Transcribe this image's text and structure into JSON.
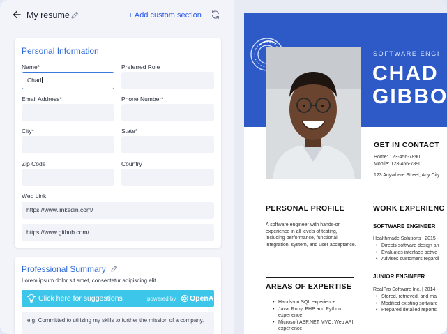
{
  "header": {
    "title": "My resume",
    "add_section_label": "+ Add custom section"
  },
  "personal": {
    "heading": "Personal Information",
    "name_label": "Name*",
    "name_value": "Chad",
    "role_label": "Preferred Role",
    "email_label": "Email Address*",
    "phone_label": "Phone Number*",
    "city_label": "City*",
    "state_label": "State*",
    "zip_label": "Zip Code",
    "country_label": "Country",
    "weblink_label": "Web Link",
    "links": [
      "https://www.linkedin.com/",
      "https://www.github.com/"
    ]
  },
  "summary": {
    "heading": "Professional Summary",
    "subtext": "Lorem ipsum dolor sit amet, consectetur adipiscing elit.",
    "suggest_label": "Click here for suggestions",
    "powered_by": "powered by",
    "provider": "OpenAI",
    "placeholder": "e.g. Committed to utilizing my skills to further the mission of a company."
  },
  "resume": {
    "role": "SOFTWARE ENGI",
    "first_name": "CHAD",
    "last_name": "GIBBO",
    "contact_heading": "GET IN CONTACT",
    "home_phone": "Home: 123-456-7890",
    "mobile_phone": "Mobile: 123-456-7890",
    "address": "123 Anywhere Street, Any City",
    "profile_heading": "PERSONAL PROFILE",
    "profile_text": "A software engineer with hands-on experience in all levels of testing, including performance, functional, integration, system, and user acceptance.",
    "expertise_heading": "AREAS OF EXPERTISE",
    "expertise": [
      "Hands-on SQL experience",
      "Java, Ruby, PHP and Python experience",
      "Microsoft ASP.NET MVC, Web API experience"
    ],
    "experience_heading": "WORK EXPERIENC",
    "job1_title": "SOFTWARE ENGINEER",
    "job1_company": "Healthmade Solutions | 2015 -",
    "job1_bullets": [
      "Directs software design an",
      "Evaluates interface betwe",
      "Advises customers regardi"
    ],
    "job2_title": "JUNIOR ENGINEER",
    "job2_company": "RealPro Software Inc. | 2014 -",
    "job2_bullets": [
      "Stored, retrieved, and ma",
      "Modified existing software",
      "Prepared detailed reports"
    ]
  },
  "colors": {
    "accent": "#2f5bea",
    "section_title": "#2f6ad6",
    "suggest_bar": "#3bc6ea",
    "resume_banner": "#2d5ac7"
  },
  "icons": [
    "back-arrow-icon",
    "pencil-icon",
    "refresh-icon",
    "lightbulb-icon",
    "openai-icon",
    "seal-icon"
  ]
}
